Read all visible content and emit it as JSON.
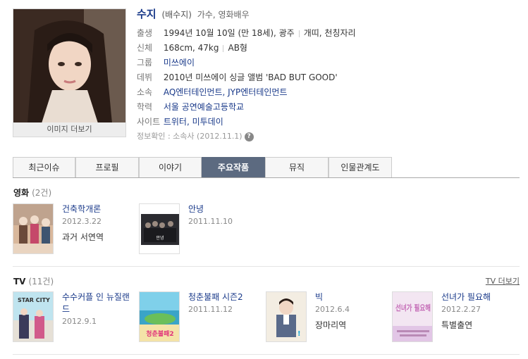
{
  "profile": {
    "name": "수지",
    "name_hanja": "(배수지)",
    "job": "가수, 영화배우",
    "photo_caption": "이미지 더보기",
    "rows": {
      "birth": {
        "label": "출생",
        "value": "1994년 10월 10일 (만 18세), 광주",
        "extra": "개띠, 천칭자리"
      },
      "body": {
        "label": "신체",
        "value": "168cm, 47kg",
        "extra": "AB형"
      },
      "group": {
        "label": "그룹",
        "value": "미쓰에이"
      },
      "debut": {
        "label": "데뷔",
        "value": "2010년 미쓰에이 싱글 앨범 'BAD BUT GOOD'"
      },
      "agency": {
        "label": "소속",
        "value": "AQ엔터테인먼트, JYP엔터테인먼트"
      },
      "education": {
        "label": "학력",
        "value": "서울 공연예술고등학교"
      },
      "site": {
        "label": "사이트",
        "value": "트위터, 미투데이"
      }
    },
    "verify": "정보확인 : 소속사 (2012.11.1)",
    "help_icon": "?"
  },
  "tabs": [
    "최근이슈",
    "프로필",
    "이야기",
    "주요작품",
    "뮤직",
    "인물관계도"
  ],
  "active_tab": "주요작품",
  "movies": {
    "title": "영화",
    "count": "(2건)",
    "items": [
      {
        "title": "건축학개론",
        "date": "2012.3.22",
        "role": "과거 서연역"
      },
      {
        "title": "안녕",
        "date": "2011.11.10",
        "role": ""
      }
    ]
  },
  "tv": {
    "title": "TV",
    "count": "(11건)",
    "more": "TV 더보기",
    "items": [
      {
        "title": "수수커플 인 뉴질랜드",
        "date": "2012.9.1",
        "role": ""
      },
      {
        "title": "청춘불패 시즌2",
        "date": "2011.11.12",
        "role": ""
      },
      {
        "title": "빅",
        "date": "2012.6.4",
        "role": "장마리역"
      },
      {
        "title": "선녀가 필요해",
        "date": "2012.2.27",
        "role": "특별출연"
      }
    ]
  },
  "poster_text": {
    "starcity": "STAR CITY",
    "chungchun": "청춘불패2",
    "seonnyeo": "선녀가 필요해"
  },
  "colors": {
    "link": "#1a3a8a",
    "active_tab": "#5c6a80"
  }
}
